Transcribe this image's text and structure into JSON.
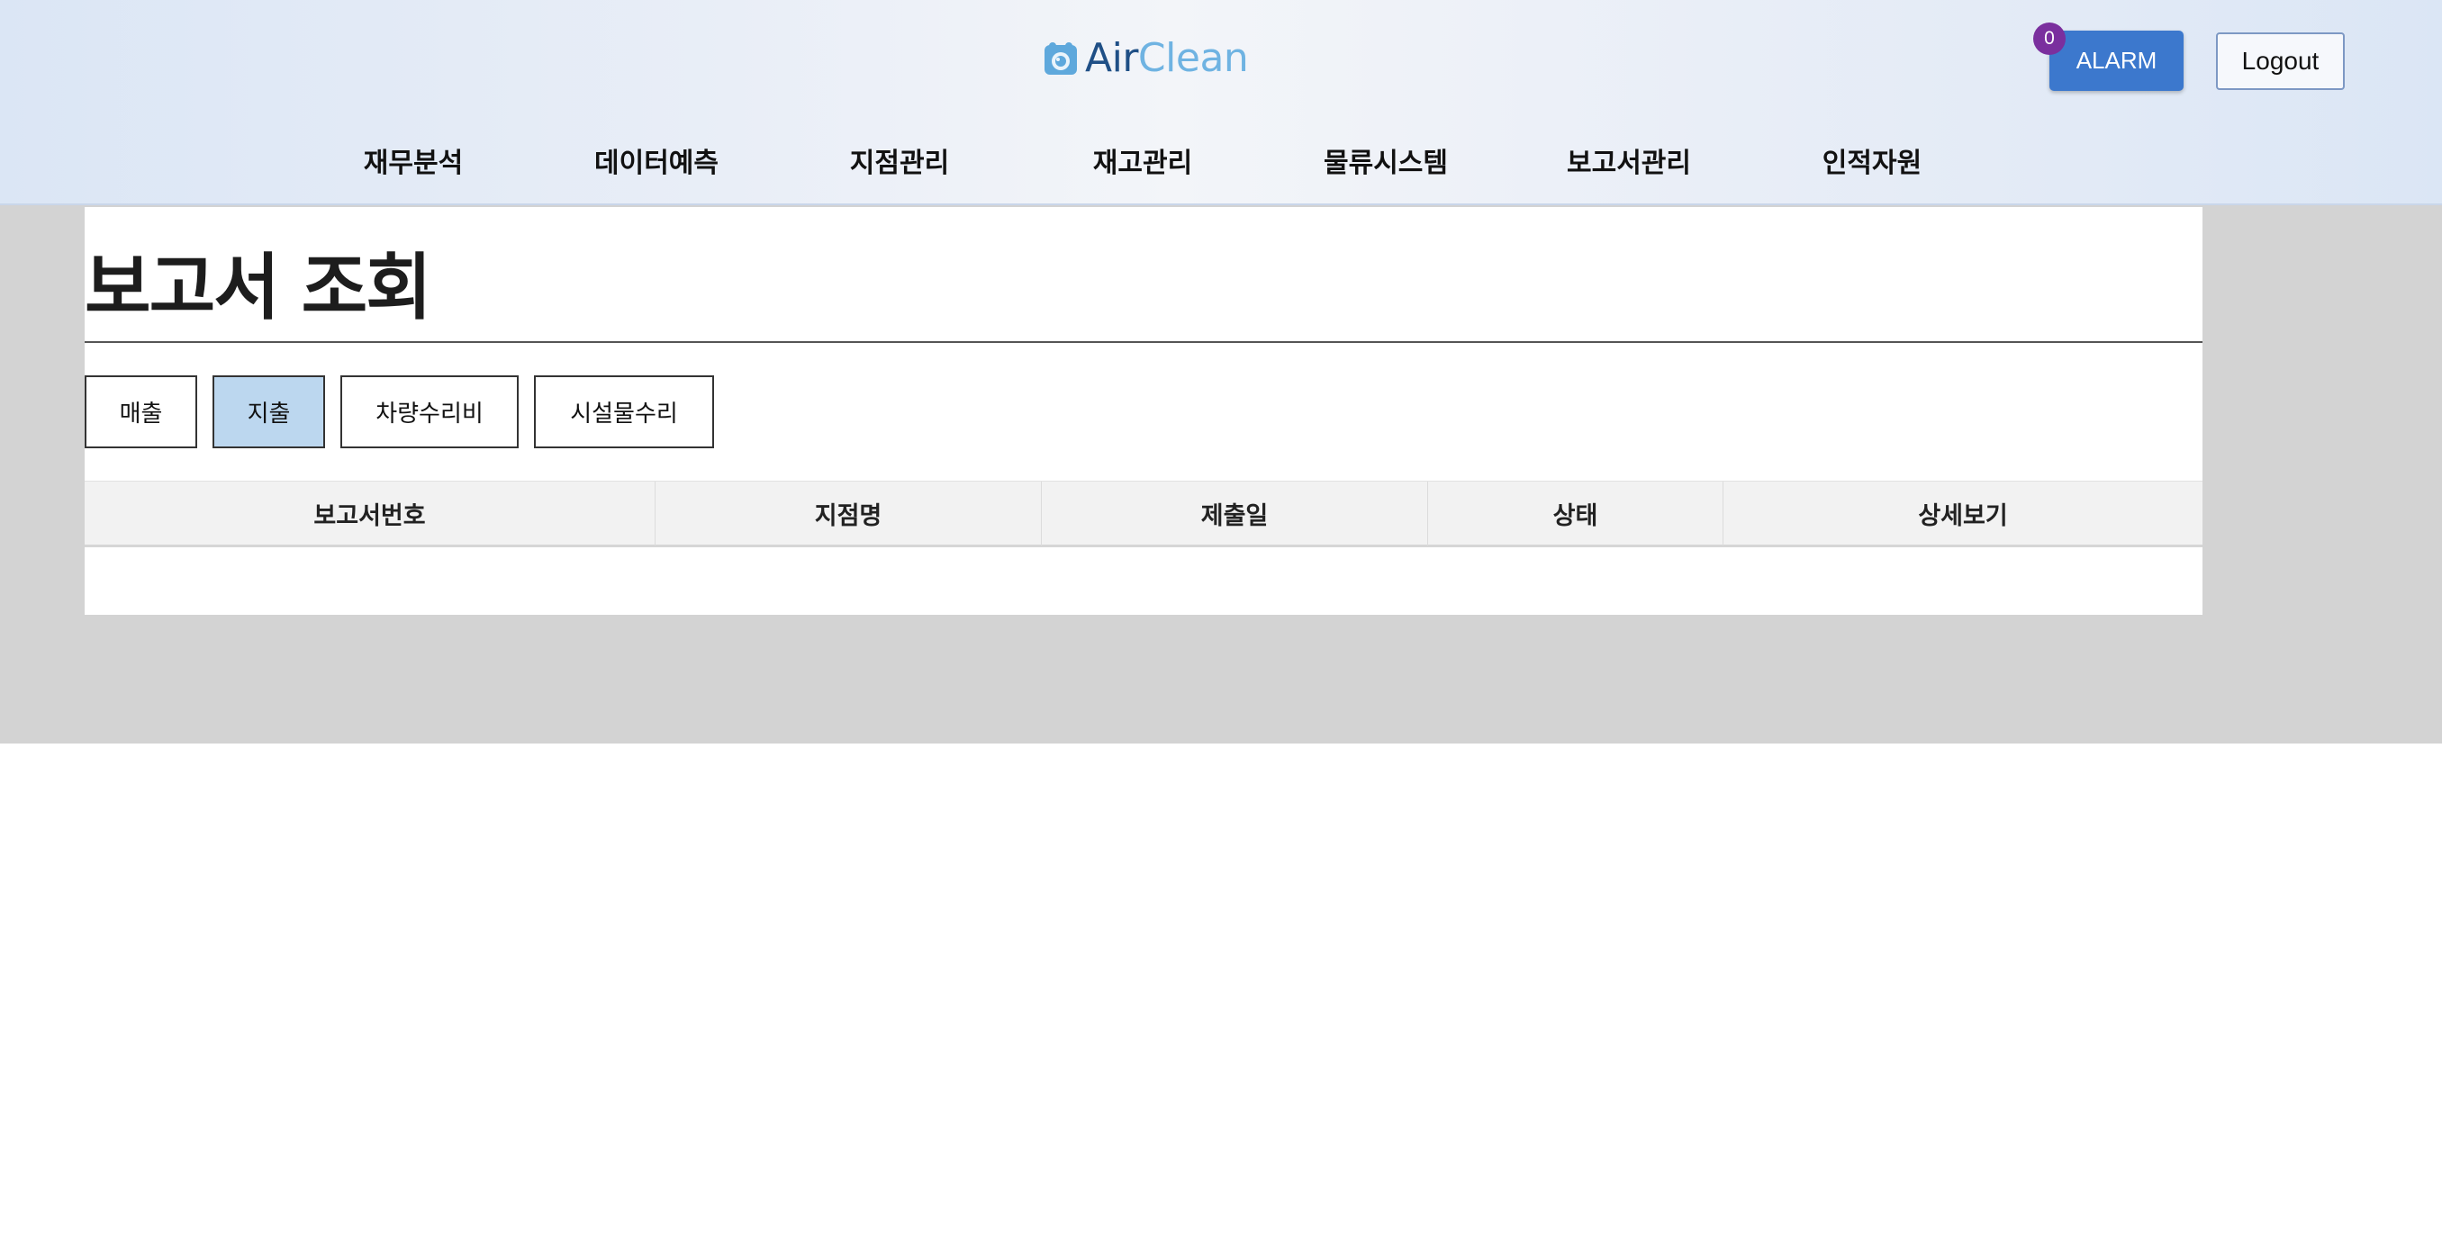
{
  "header": {
    "logo": {
      "part1": "Air",
      "part2": "Clean",
      "icon": "aircleaner-icon"
    },
    "alarm": {
      "label": "ALARM",
      "count": "0"
    },
    "logout_label": "Logout"
  },
  "nav": {
    "items": [
      {
        "label": "재무분석"
      },
      {
        "label": "데이터예측"
      },
      {
        "label": "지점관리"
      },
      {
        "label": "재고관리"
      },
      {
        "label": "물류시스템"
      },
      {
        "label": "보고서관리"
      },
      {
        "label": "인적자원"
      }
    ]
  },
  "main": {
    "title": "보고서 조회",
    "tabs": [
      {
        "label": "매출",
        "active": false
      },
      {
        "label": "지출",
        "active": true
      },
      {
        "label": "차량수리비",
        "active": false
      },
      {
        "label": "시설물수리",
        "active": false
      }
    ],
    "table": {
      "columns": [
        "보고서번호",
        "지점명",
        "제출일",
        "상태",
        "상세보기"
      ],
      "rows": []
    }
  },
  "colors": {
    "alarm_button": "#3c78cd",
    "alarm_badge": "#7a2f9e",
    "active_tab": "#bcd7ef",
    "page_background": "#d3d3d3"
  }
}
